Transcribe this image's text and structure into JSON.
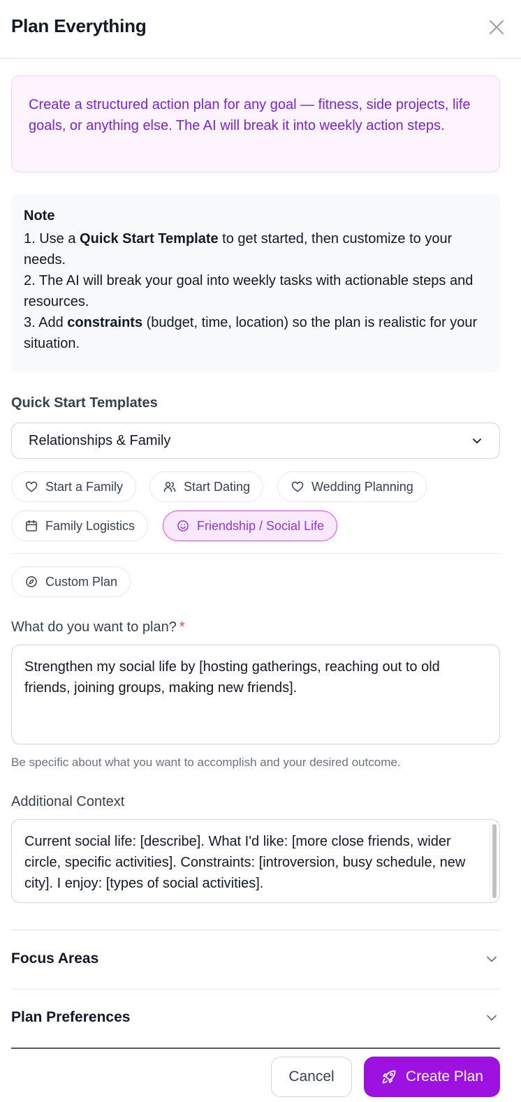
{
  "dialog": {
    "title": "Plan Everything"
  },
  "intro": {
    "text": "Create a structured action plan for any goal — fitness, side projects, life goals, or anything else. The AI will break it into weekly action steps."
  },
  "note": {
    "title": "Note",
    "item1_prefix": "1. Use a ",
    "item1_bold": "Quick Start Template",
    "item1_suffix": " to get started, then customize to your needs.",
    "item2": "2. The AI will break your goal into weekly tasks with actionable steps and resources.",
    "item3_prefix": "3. Add ",
    "item3_bold": "constraints",
    "item3_suffix": " (budget, time, location) so the plan is realistic for your situation."
  },
  "templates": {
    "label": "Quick Start Templates",
    "selected_category": "Relationships & Family",
    "chips": [
      {
        "label": "Start a Family",
        "icon": "heart-icon",
        "active": false
      },
      {
        "label": "Start Dating",
        "icon": "users-icon",
        "active": false
      },
      {
        "label": "Wedding Planning",
        "icon": "heart-icon",
        "active": false
      },
      {
        "label": "Family Logistics",
        "icon": "calendar-icon",
        "active": false
      },
      {
        "label": "Friendship / Social Life",
        "icon": "smile-icon",
        "active": true
      }
    ],
    "custom_plan_label": "Custom Plan"
  },
  "goal": {
    "label": "What do you want to plan?",
    "required_marker": "*",
    "value": "Strengthen my social life by [hosting gatherings, reaching out to old friends, joining groups, making new friends].",
    "helper": "Be specific about what you want to accomplish and your desired outcome."
  },
  "context": {
    "label": "Additional Context",
    "value": "Current social life: [describe]. What I'd like: [more close friends, wider circle, specific activities]. Constraints: [introversion, busy schedule, new city]. I enjoy: [types of social activities]."
  },
  "sections": {
    "focus_areas": "Focus Areas",
    "plan_preferences": "Plan Preferences"
  },
  "footer": {
    "cancel_label": "Cancel",
    "create_label": "Create Plan"
  },
  "colors": {
    "accent": "#9d12e0",
    "intro_bg": "#fdf4ff",
    "intro_text": "#7e22ce",
    "active_chip_bg": "#fae8ff",
    "required": "#ef4444"
  }
}
